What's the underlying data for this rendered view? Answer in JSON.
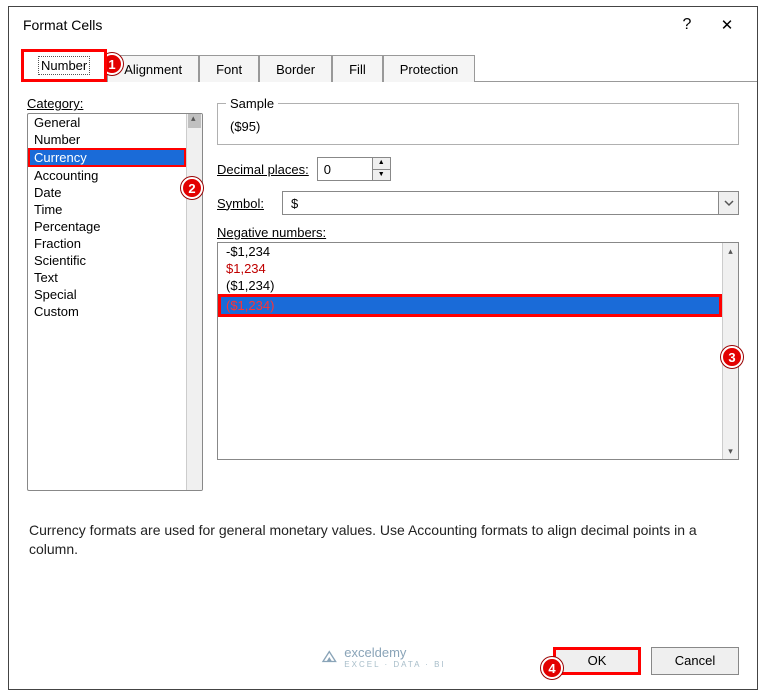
{
  "title": "Format Cells",
  "help_icon": "?",
  "close_icon": "✕",
  "tabs": [
    "Number",
    "Alignment",
    "Font",
    "Border",
    "Fill",
    "Protection"
  ],
  "category_label": "Category:",
  "categories": [
    "General",
    "Number",
    "Currency",
    "Accounting",
    "Date",
    "Time",
    "Percentage",
    "Fraction",
    "Scientific",
    "Text",
    "Special",
    "Custom"
  ],
  "sample_legend": "Sample",
  "sample_value": "($95)",
  "decimal_label": "Decimal places:",
  "decimal_value": "0",
  "symbol_label": "Symbol:",
  "symbol_value": "$",
  "neg_label": "Negative numbers:",
  "neg_items": {
    "a": "-$1,234",
    "b": "$1,234",
    "c": "($1,234)",
    "d": "($1,234)"
  },
  "description": "Currency formats are used for general monetary values.  Use Accounting formats to align decimal points in a column.",
  "ok": "OK",
  "cancel": "Cancel",
  "watermark": "exceldemy",
  "watermark_sub": "EXCEL · DATA · BI",
  "callouts": {
    "c1": "1",
    "c2": "2",
    "c3": "3",
    "c4": "4"
  }
}
